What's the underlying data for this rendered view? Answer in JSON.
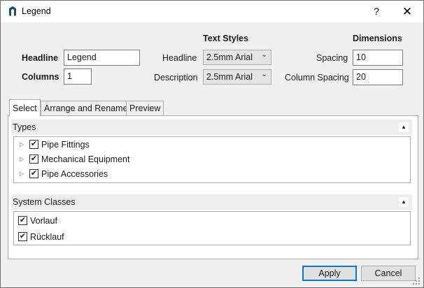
{
  "window": {
    "title": "Legend",
    "help_glyph": "?",
    "close_glyph": "✕"
  },
  "headline": {
    "label": "Headline",
    "value": "Legend"
  },
  "columns": {
    "label": "Columns",
    "value": "1"
  },
  "text_styles": {
    "heading": "Text Styles",
    "headline": {
      "label": "Headline",
      "value": "2.5mm Arial"
    },
    "description": {
      "label": "Description",
      "value": "2.5mm Arial"
    }
  },
  "dimensions": {
    "heading": "Dimensions",
    "spacing": {
      "label": "Spacing",
      "value": "10"
    },
    "column_spacing": {
      "label": "Column Spacing",
      "value": "20"
    }
  },
  "tabs": [
    {
      "label": "Select",
      "active": true
    },
    {
      "label": "Arrange and Rename",
      "active": false
    },
    {
      "label": "Preview",
      "active": false
    }
  ],
  "types": {
    "header": "Types",
    "items": [
      {
        "label": "Pipe Fittings",
        "checked": true
      },
      {
        "label": "Mechanical Equipment",
        "checked": true
      },
      {
        "label": "Pipe Accessories",
        "checked": true
      }
    ]
  },
  "system_classes": {
    "header": "System Classes",
    "items": [
      {
        "label": "Vorlauf",
        "checked": true
      },
      {
        "label": "Rücklauf",
        "checked": true
      }
    ]
  },
  "buttons": {
    "apply": "Apply",
    "cancel": "Cancel"
  },
  "icons": {
    "app": "app-logo-icon",
    "dropdown": "chevron-down-icon",
    "collapse": "caret-up-icon",
    "expand": "triangle-right-icon",
    "check": "checkmark-icon",
    "grip": "resize-grip-icon"
  },
  "colors": {
    "accent": "#0078d7",
    "titlebar": "#ffffff",
    "section_header": "#eeeeee"
  }
}
